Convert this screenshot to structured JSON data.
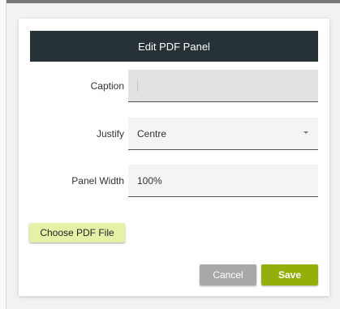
{
  "dialog": {
    "title": "Edit PDF Panel"
  },
  "form": {
    "caption": {
      "label": "Caption",
      "value": ""
    },
    "justify": {
      "label": "Justify",
      "value": "Centre"
    },
    "panel_width": {
      "label": "Panel Width",
      "value": "100%"
    }
  },
  "buttons": {
    "choose_pdf": "Choose PDF File",
    "cancel": "Cancel",
    "save": "Save"
  },
  "colors": {
    "titlebar": "#263235",
    "save_button": "#93b00a",
    "cancel_button": "#a8a8a8",
    "choose_button": "#e6f1a8"
  },
  "icons": {
    "justify_dropdown": "caret-down-icon"
  }
}
